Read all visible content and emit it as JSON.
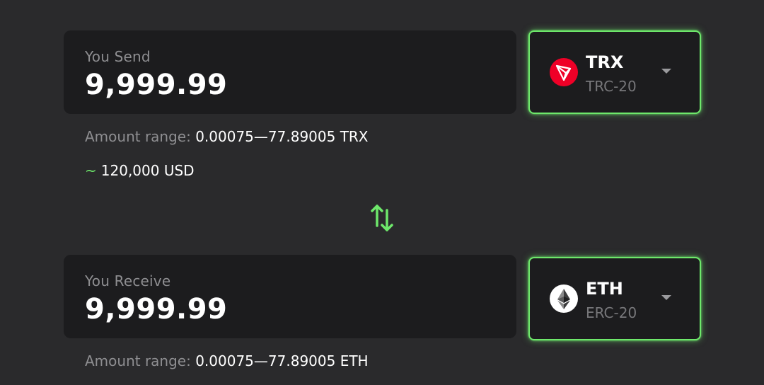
{
  "send": {
    "label": "You Send",
    "amount": "9,999.99",
    "currency": {
      "ticker": "TRX",
      "network": "TRC-20",
      "icon": "tron-logo-icon",
      "icon_color": "#ef0027"
    },
    "range_label": "Amount range:",
    "range_value": "0.00075—77.89005 TRX",
    "usd_tilde": "~",
    "usd_value": "120,000 USD"
  },
  "receive": {
    "label": "You Receive",
    "amount": "9,999.99",
    "currency": {
      "ticker": "ETH",
      "network": "ERC-20",
      "icon": "ethereum-logo-icon",
      "icon_color": "#ffffff"
    },
    "range_label": "Amount range:",
    "range_value": "0.00075—77.89005 ETH"
  },
  "swap": {
    "icon": "swap-arrows-icon"
  },
  "colors": {
    "background": "#2a2a2c",
    "panel": "#1c1c1e",
    "accent": "#6ee86b",
    "muted_text": "#8e8e91"
  }
}
